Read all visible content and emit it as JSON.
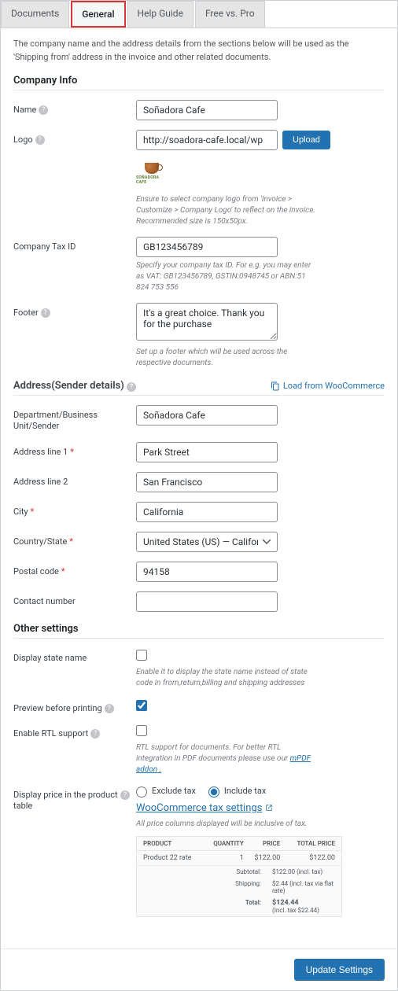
{
  "tabs": {
    "documents": "Documents",
    "general": "General",
    "help": "Help Guide",
    "free": "Free vs. Pro"
  },
  "intro": "The company name and the address details from the sections below will be used as the 'Shipping from' address in the invoice and other related documents.",
  "sections": {
    "company": "Company Info",
    "address": "Address(Sender details)",
    "other": "Other settings"
  },
  "loadFromWoo": "Load from WooCommerce",
  "company": {
    "nameLabel": "Name",
    "nameValue": "Soñadora Cafe",
    "logoLabel": "Logo",
    "logoValue": "http://soadora-cafe.local/wp",
    "uploadBtn": "Upload",
    "logoBrand": "SOÑADORA CAFE",
    "logoHint": "Ensure to select company logo from 'Invoice > Customize > Company Logo' to reflect on the invoice. Recommended size is 150x50px.",
    "taxLabel": "Company Tax ID",
    "taxValue": "GB123456789",
    "taxHint": "Specify your company tax ID. For e.g. you may enter as VAT: GB123456789, GSTIN:0948745 or ABN:51 824 753 556",
    "footerLabel": "Footer",
    "footerValue": "It's a great choice. Thank you for the purchase",
    "footerHint": "Set up a footer which will be used across the respective documents."
  },
  "address": {
    "deptLabel": "Department/Business Unit/Sender",
    "deptValue": "Soñadora Cafe",
    "line1Label": "Address line 1",
    "line1Value": "Park Street",
    "line2Label": "Address line 2",
    "line2Value": "San Francisco",
    "cityLabel": "City",
    "cityValue": "California",
    "countryLabel": "Country/State",
    "countryValue": "United States (US) — California",
    "postalLabel": "Postal code",
    "postalValue": "94158",
    "contactLabel": "Contact number",
    "contactValue": ""
  },
  "other": {
    "stateLabel": "Display state name",
    "stateHint": "Enable it to display the state name instead of state code in from,return,billing and shipping addresses",
    "previewLabel": "Preview before printing",
    "rtlLabel": "Enable RTL support",
    "rtlHint": "RTL support for documents. For better RTL integration in PDF documents please use our ",
    "rtlLink": "mPDF addon .",
    "priceLabel": "Display price in the product table",
    "excludeTax": "Exclude tax",
    "includeTax": "Include tax",
    "taxSettingsLink": "WooCommerce tax settings",
    "priceHint": "All price columns displayed will be inclusive of tax."
  },
  "priceTable": {
    "headers": {
      "product": "PRODUCT",
      "qty": "QUANTITY",
      "price": "PRICE",
      "total": "TOTAL PRICE"
    },
    "row": {
      "product": "Product 22 rate",
      "qty": "1",
      "price": "$122.00",
      "total": "$122.00"
    },
    "subtotalLabel": "Subtotal:",
    "subtotalValue": "$122.00 (incl. tax)",
    "shippingLabel": "Shipping:",
    "shippingValue": "$2.44 (incl. tax via flat rate)",
    "totalLabel": "Total:",
    "totalValue": "$124.44",
    "totalSub": "(Incl. tax $22.44)"
  },
  "updateBtn": "Update Settings"
}
